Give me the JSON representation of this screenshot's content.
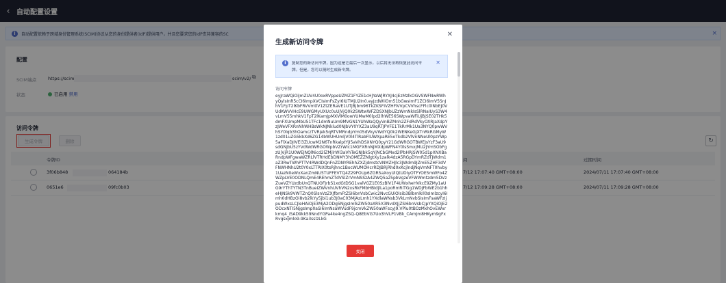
{
  "header": {
    "back_icon": "‹",
    "title": "自动配置设置"
  },
  "info_banner": {
    "text": "自动配置依赖于跨域身份管理系统(SCIM)协议从您的身份提供者(IdP)提供用户，并且您要求您的IdP支持兼容的SC",
    "close": "×"
  },
  "config": {
    "title": "配置",
    "scim_label": "SCIM端点",
    "scim_prefix": "https://scim",
    "scim_suffix": "scim/v2/",
    "status_label": "状态",
    "status_value": "已启用",
    "status_action": "禁用",
    "status_color": "#50b371"
  },
  "tokens": {
    "title": "访问令牌",
    "generate_button": "生成令牌",
    "delete_button": "删除",
    "columns": {
      "id": "令牌ID",
      "created": "间",
      "expires": "过期时间"
    },
    "rows": [
      {
        "id_start": "3f06b848",
        "id_end": "064184b",
        "created": "7/12 17:07:40 GMT+08:00",
        "expires": "2024/07/11 17:07:40 GMT+08:00"
      },
      {
        "id_start": "0651e6",
        "id_end": "09fc0b03",
        "created": "7/12 17:09:28 GMT+08:00",
        "expires": "2024/07/11 17:09:28 GMT+08:00"
      }
    ]
  },
  "modal": {
    "title": "生成新访问令牌",
    "warning": "复制您的新访问令牌，因为这是它最后一次显示。以后将无法再恢复此访问令牌。但是，您可以随时生成新令牌。",
    "token_label": "访问令牌",
    "token_value": "eyJraWQiOiJmZUV4U0oxRVppeUZMZ1FYZE1cHJYaWJRYXJ4cjEzMzlkOGVSWFNwRWhyQylsInR5cCI6ImpXVCIsImFsZyI6IUTMjU2In0.eyJzdWIiOm51bGwsImF1ZCI6ImV5SnJhV1FpT2lKbFRVVmtlV1ZtZERaVE1UTjBjbm96TkZKSFIVZHFiVVpCVVhscFFlc0lNbEJ0VUdKWVVHcE9UWGMyUXUc0uUjVjQ0k2SWtwWFZDSXNJbUZzWmNkIsSlRNaIUyS3W4vLmV55mhkV1FpT2lKamJpMXVlM0owYUMwM0lpd2lhWE56SWpvaWFiUjBjSE02THk5dmFXUmpMbU51TFc1dmNuUm9MVGN1YUhWaQQyVnBZMnh2ZFdRdVkyOXRJaXdpYzJWeVFXRnNhWHBsWkNJNklud0NJbVY0YXZ3aU9qRTJPVFE1TkRrMk1Ua3NYQ0pwWVhSY0lqb3hOamczTVRjek5qRTVMRndpYm05dVkyVWdYQ0k2WENKeGJXTnRkRGMyW1zd01uZG5kbXd6ZG14bWUHUmljV0l4TlRabFlUWXpaRE5oTkdb2VlVnNNeUl0pzYWp5aFlXaDJIVEl3ZUcwM2N6TnRkalptYjI5aVhDSXNYQ0pyY21GdWRGOTBWEJsYzF3aU9sdGNJbU5zYVdWdWRGOWpbVZrWIc1MGFXRnNJMXdpWFN4Y0lsSmxjMU2JYm5ObFgzUjVjR1U0WEJNQlNicd2lZMjlrWl3aVhTeGNJbk5qYjNCbGMxd2lPbHRjSW05d1pXNXBaRndpWFgwaWZRLlVTRHdEbDNMY3hOMEZZNlgtXy1zalk4dzA5RGpDYmRZdTJWdm1aZ3RwTWhPTTV4RWdDQnFnZDNYREhhZXZjdmstcVNMZHJlc3JWdm9JZmE5ZHF3dVFNWHNhU2t0Y0xLTTRIX0tsRjhnc1BocWUMOHcrRDJBRjRhd0xKcjlndjNqVmNFT0hvby1UazN0eWxXanZmNU5TUFFEVTQ4Z29FOUp6ZGR5aXoyUlQtUDIyOTFYOE5mWFo4ZWZpLVE0ODNLQmE4REhmZTdVSlZrVmNSSzA4ZWQ5a25pbVgzeVFWWmtzdm5DVzZueVZYUzdbUnQTNUOFJrbS1xdGtDSG1valVGZ1E0SzBlV1F4UWxheHVkcE9ZMy1aUG9rYThTYTN3TnBueIZWVnhUVhVN2xsRkFMbHBIdjlLa1poRmRiTGg1WDJFbWE2b1hheHJNSk9VWTZnQ0SlsnVzZXJfbmFtZSI6bnVsbCwic2NvcGUiOlsib3BlbmlkIl0sImlzcyI6Imh0dHBzOi8vb2lkYy5jbi1ub3J0aC03MjAzLmh1YXdlaWNsb3VkLmNvbSIsImFsaWFzIjpudWxsLCJleHAiOjE3MjA2ODg5NjgsImlkZW50aXR5X3NvdXJjZSI6bnVsbCJpYXQiOjE2ODcxNTI5NjgsImp0aSI6ImNsaWVudF9jcmVkZW50aWFscyJ9.VPlu0tBOzMxhOvEWxrkmq4_i5AD9kk59NndYGPa4ke4ngZSQ-Q8EbVG7Uo3hVLP1VBk_CAmJm8HKym9gFxRvgsxjmlo9-9Ka3sslzLkG",
    "close_button": "关闭",
    "accent": "#e53935"
  }
}
